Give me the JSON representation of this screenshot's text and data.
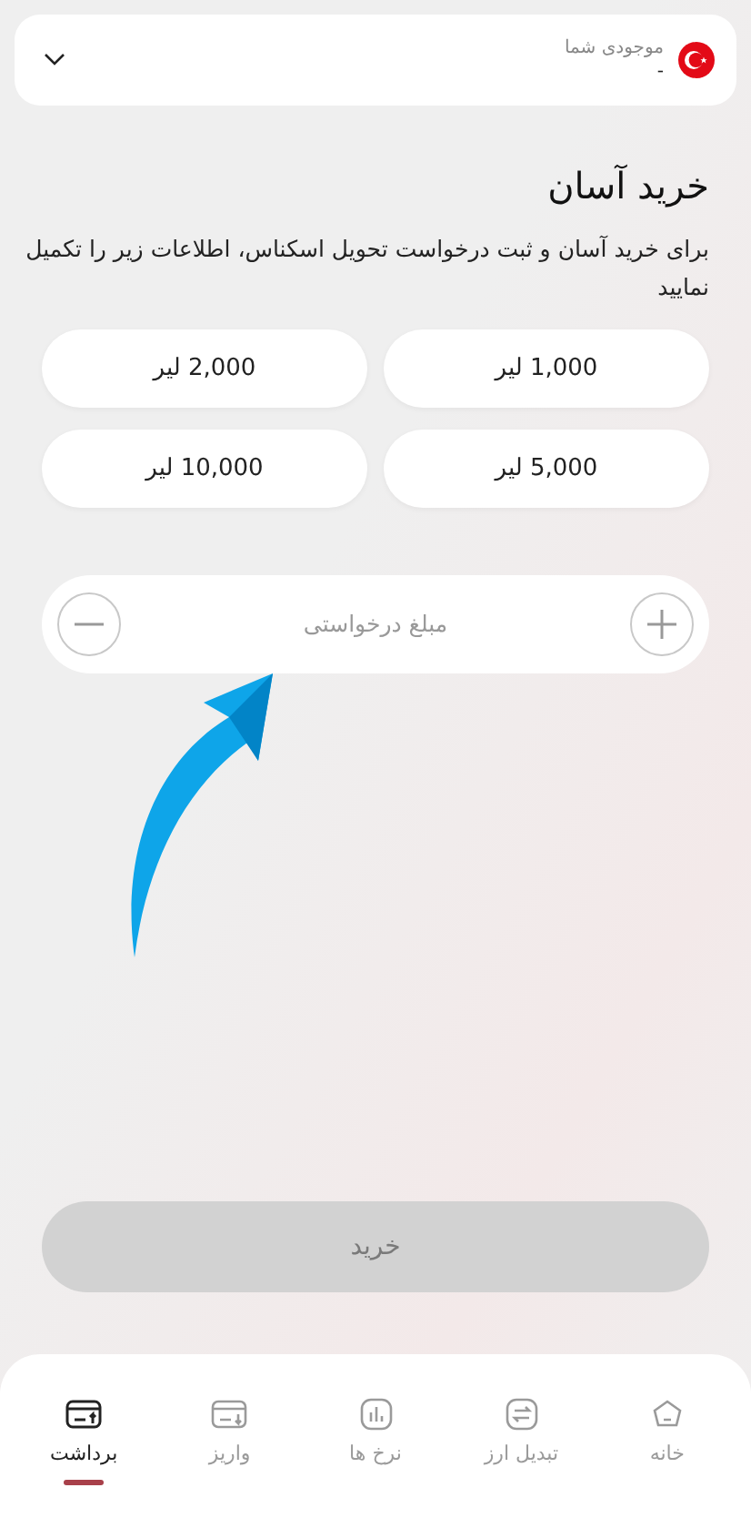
{
  "balance": {
    "label": "موجودی شما",
    "value": "-"
  },
  "title": "خرید آسان",
  "description": "برای خرید آسان و ثبت درخواست تحویل اسکناس، اطلاعات زیر را تکمیل نمایید",
  "presets": [
    {
      "label": "1,000 لیر"
    },
    {
      "label": "2,000 لیر"
    },
    {
      "label": "5,000 لیر"
    },
    {
      "label": "10,000 لیر"
    }
  ],
  "amount_field": {
    "placeholder": "مبلغ درخواستی"
  },
  "buy_button": {
    "label": "خرید",
    "disabled": true
  },
  "nav": [
    {
      "label": "خانه",
      "kind": "home",
      "selected": false
    },
    {
      "label": "تبدیل ارز",
      "kind": "exchange",
      "selected": false
    },
    {
      "label": "نرخ ها",
      "kind": "rates",
      "selected": false
    },
    {
      "label": "واریز",
      "kind": "deposit",
      "selected": false
    },
    {
      "label": "برداشت",
      "kind": "withdraw",
      "selected": true
    }
  ]
}
